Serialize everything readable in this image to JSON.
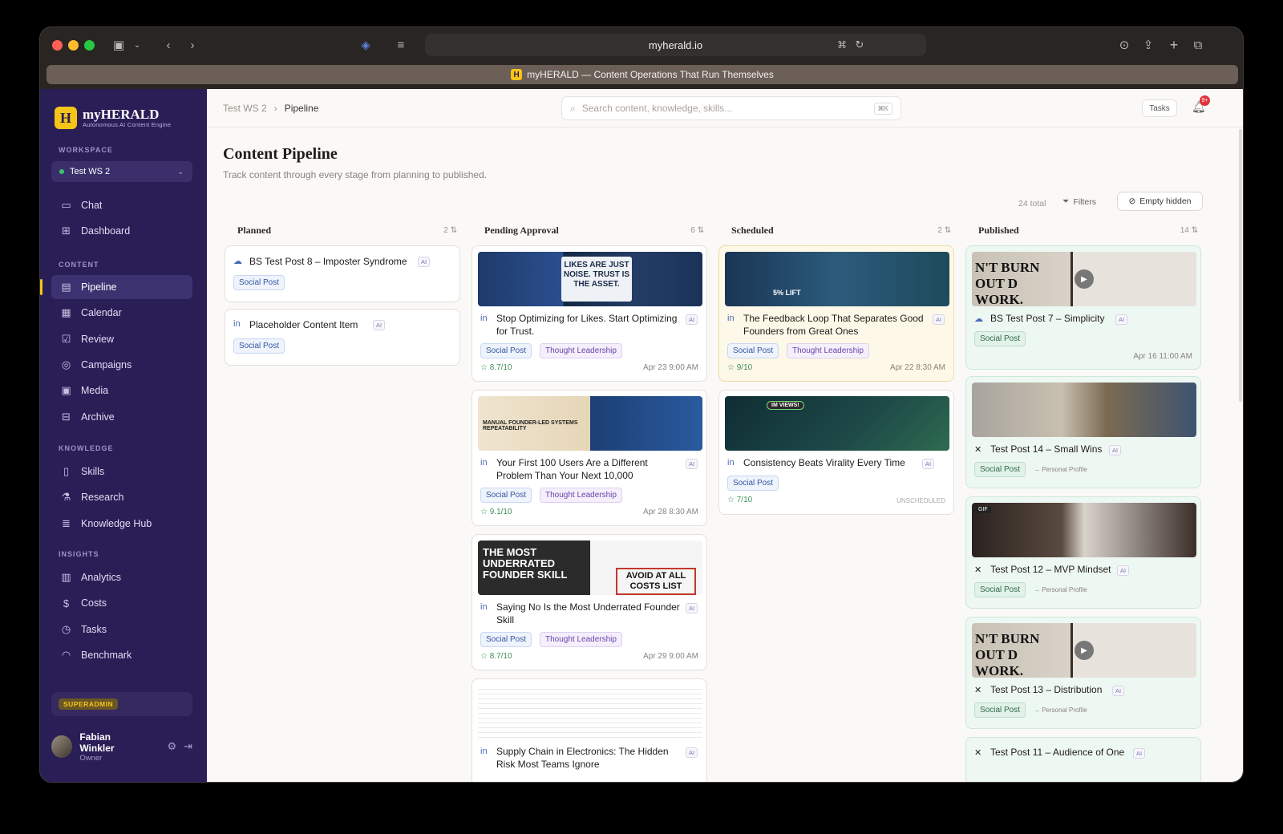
{
  "browser": {
    "url": "myherald.io",
    "banner": "myHERALD — Content Operations That Run Themselves",
    "banner_badge": "H"
  },
  "sidebar": {
    "logo": {
      "badge": "H",
      "name": "myHERALD",
      "tagline": "Autonomous AI Content Engine"
    },
    "workspace_label": "WORKSPACE",
    "workspace": "Test WS 2",
    "items": [
      {
        "label": "Chat",
        "icon": "chat-bubble-icon",
        "glyph": "▭"
      },
      {
        "label": "Dashboard",
        "icon": "dashboard-grid-icon",
        "glyph": "⊞"
      }
    ],
    "content_label": "CONTENT",
    "content": [
      {
        "label": "Pipeline",
        "icon": "pipeline-icon",
        "glyph": "▤",
        "active": true
      },
      {
        "label": "Calendar",
        "icon": "calendar-icon",
        "glyph": "▦"
      },
      {
        "label": "Review",
        "icon": "review-check-icon",
        "glyph": "☑"
      },
      {
        "label": "Campaigns",
        "icon": "target-icon",
        "glyph": "◎"
      },
      {
        "label": "Media",
        "icon": "image-icon",
        "glyph": "▣"
      },
      {
        "label": "Archive",
        "icon": "archive-box-icon",
        "glyph": "⊟"
      }
    ],
    "knowledge_label": "KNOWLEDGE",
    "knowledge": [
      {
        "label": "Skills",
        "icon": "book-icon",
        "glyph": "▯"
      },
      {
        "label": "Research",
        "icon": "flask-icon",
        "glyph": "⚗"
      },
      {
        "label": "Knowledge Hub",
        "icon": "database-icon",
        "glyph": "≣"
      }
    ],
    "insights_label": "INSIGHTS",
    "insights": [
      {
        "label": "Analytics",
        "icon": "bar-chart-icon",
        "glyph": "▥"
      },
      {
        "label": "Costs",
        "icon": "dollar-icon",
        "glyph": "$"
      },
      {
        "label": "Tasks",
        "icon": "timer-icon",
        "glyph": "◷"
      },
      {
        "label": "Benchmark",
        "icon": "gauge-icon",
        "glyph": "◠"
      }
    ],
    "role": "SUPERADMIN",
    "user": {
      "name": "Fabian Winkler",
      "role": "Owner"
    }
  },
  "header": {
    "breadcrumb": [
      "Test WS 2",
      "Pipeline"
    ],
    "search_placeholder": "Search content, knowledge, skills...",
    "search_kbd": "⌘K",
    "tasks": "Tasks",
    "notif": "9+"
  },
  "page": {
    "title": "Content Pipeline",
    "subtitle": "Track content through every stage from planning to published.",
    "total": "24 total",
    "filters": "Filters",
    "empty_hidden": "Empty hidden"
  },
  "columns": [
    {
      "name": "Planned",
      "count": "2"
    },
    {
      "name": "Pending Approval",
      "count": "6"
    },
    {
      "name": "Scheduled",
      "count": "2"
    },
    {
      "name": "Published",
      "count": "14"
    }
  ],
  "cards": {
    "planned": [
      {
        "title": "BS Test Post 8 – Imposter Syndrome",
        "tag": "Social Post",
        "ai": "AI"
      },
      {
        "title": "Placeholder Content Item",
        "tag": "Social Post",
        "ai": "AI"
      }
    ],
    "pending": [
      {
        "title": "Stop Optimizing for Likes. Start Optimizing for Trust.",
        "tags": [
          "Social Post",
          "Thought Leadership"
        ],
        "score": "8.7/10",
        "date": "Apr 23",
        "time": "9:00 AM",
        "ai": "AI",
        "img_text": "LIKES ARE JUST NOISE. TRUST IS THE ASSET."
      },
      {
        "title": "Your First 100 Users Are a Different Problem Than Your Next 10,000",
        "tags": [
          "Social Post",
          "Thought Leadership"
        ],
        "score": "9.1/10",
        "date": "Apr 28",
        "time": "8:30 AM",
        "ai": "AI",
        "img_text": "MANUAL FOUNDER-LED SYSTEMS REPEATABILITY"
      },
      {
        "title": "Saying No Is the Most Underrated Founder Skill",
        "tags": [
          "Social Post",
          "Thought Leadership"
        ],
        "score": "8.7/10",
        "date": "Apr 29",
        "time": "9:00 AM",
        "ai": "AI",
        "img_text": "THE MOST UNDERRATED FOUNDER SKILL",
        "img_text2": "AVOID AT ALL COSTS LIST"
      },
      {
        "title": "Supply Chain in Electronics: The Hidden Risk Most Teams Ignore",
        "ai": "AI"
      }
    ],
    "scheduled": [
      {
        "title": "The Feedback Loop That Separates Good Founders from Great Ones",
        "tags": [
          "Social Post",
          "Thought Leadership"
        ],
        "score": "9/10",
        "date": "Apr 22",
        "time": "8:30 AM",
        "ai": "AI",
        "img_text": "5% LIFT"
      },
      {
        "title": "Consistency Beats Virality Every Time",
        "tags": [
          "Social Post"
        ],
        "score": "7/10",
        "status": "UNSCHEDULED",
        "ai": "AI",
        "img_text": "IM VIEWS!"
      }
    ],
    "published": [
      {
        "title": "BS Test Post 7 – Simplicity",
        "tag": "Social Post",
        "date": "Apr 16",
        "time": "11:00 AM",
        "ai": "AI",
        "img_text": "N'T BURN OUT D WORK."
      },
      {
        "title": "Test Post 14 – Small Wins",
        "tag": "Social Post",
        "profile": "→ Personal Profile",
        "ai": "AI"
      },
      {
        "title": "Test Post 12 – MVP Mindset",
        "tag": "Social Post",
        "profile": "→ Personal Profile",
        "ai": "AI",
        "badge": "GIF"
      },
      {
        "title": "Test Post 13 – Distribution",
        "tag": "Social Post",
        "profile": "→ Personal Profile",
        "ai": "AI",
        "img_text": "N'T BURN OUT D WORK."
      },
      {
        "title": "Test Post 11 – Audience of One",
        "ai": "AI"
      }
    ]
  },
  "colors": {
    "sidebar": "#2a1e57",
    "accent": "#f5c518",
    "published_bg": "#eef8f2",
    "scheduled_bg": "#fdf8e7"
  }
}
